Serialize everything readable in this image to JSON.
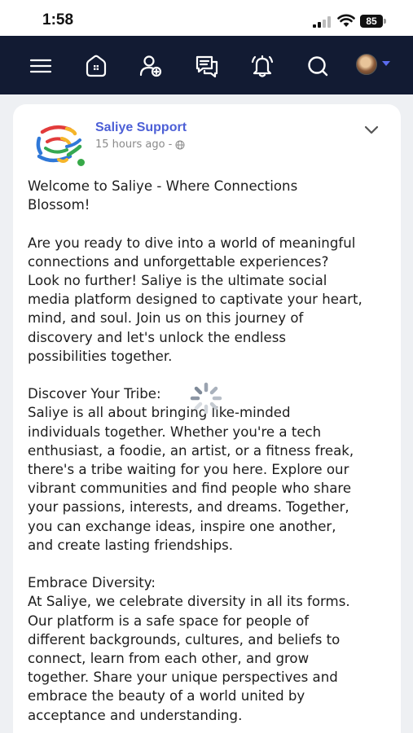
{
  "status_bar": {
    "time": "1:58",
    "battery": "85"
  },
  "nav": {
    "icons": [
      "menu-icon",
      "home-icon",
      "add-friend-icon",
      "messages-icon",
      "notifications-icon",
      "search-icon",
      "profile-avatar"
    ]
  },
  "post": {
    "author": "Saliye Support",
    "time_ago": "15 hours ago -",
    "visibility_icon": "globe-icon",
    "paragraphs": [
      {
        "lines": [
          "Welcome to Saliye - Where Connections",
          "Blossom!"
        ]
      },
      {
        "lines": [
          "Are you ready to dive into a world of meaningful",
          "connections and unforgettable experiences?",
          "Look no further! Saliye is the ultimate social",
          "media platform designed to captivate your heart,",
          "mind, and soul. Join us on this journey of",
          "discovery and let's unlock the endless",
          "possibilities together."
        ]
      },
      {
        "lines": [
          "Discover Your Tribe:",
          "Saliye is all about bringing like-minded",
          "individuals together. Whether you're a tech",
          "enthusiast, a foodie, an artist, or a fitness freak,",
          "there's a tribe waiting for you here. Explore our",
          "vibrant communities and find people who share",
          "your passions, interests, and dreams. Together,",
          "you can exchange ideas, inspire one another,",
          "and create lasting friendships."
        ]
      },
      {
        "lines": [
          "Embrace Diversity:",
          "At Saliye, we celebrate diversity in all its forms.",
          "Our platform is a safe space for people of",
          "different backgrounds, cultures, and beliefs to",
          "connect, learn from each other, and grow",
          "together. Share your unique perspectives and",
          "embrace the beauty of a world united by",
          "acceptance and understanding."
        ]
      }
    ]
  },
  "colors": {
    "nav_bg": "#121b33",
    "author": "#4c5fd6",
    "online": "#37a948"
  }
}
